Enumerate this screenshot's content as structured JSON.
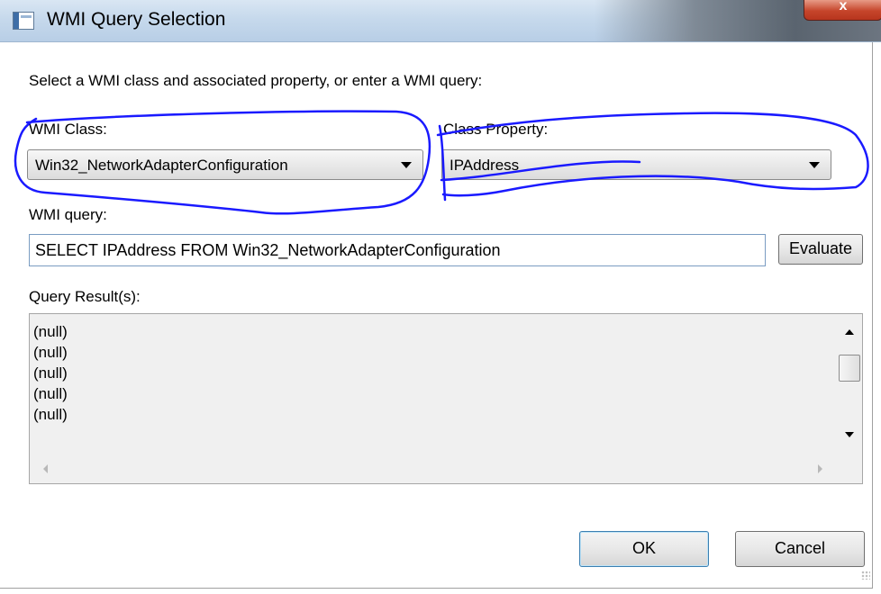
{
  "window": {
    "title": "WMI Query Selection",
    "close_glyph": "x"
  },
  "dialog": {
    "instruction": "Select a WMI class and associated property, or enter a WMI query:",
    "wmi_class": {
      "label": "WMI Class:",
      "selected": "Win32_NetworkAdapterConfiguration"
    },
    "class_property": {
      "label": "Class Property:",
      "selected": "IPAddress"
    },
    "wmi_query": {
      "label": "WMI query:",
      "value": "SELECT IPAddress FROM Win32_NetworkAdapterConfiguration"
    },
    "evaluate_button": "Evaluate",
    "results": {
      "label": "Query Result(s):",
      "rows": [
        "(null)",
        "(null)",
        "(null)",
        "(null)",
        "(null)"
      ]
    },
    "ok_button": "OK",
    "cancel_button": "Cancel"
  },
  "icons": {
    "app": "window-app-icon",
    "close": "close-icon",
    "dropdown": "chevron-down-icon",
    "scroll_up": "scroll-up-arrow-icon",
    "scroll_down": "scroll-down-arrow-icon",
    "scroll_left": "scroll-left-arrow-icon",
    "scroll_right": "scroll-right-arrow-icon"
  },
  "colors": {
    "annotation_ink": "#1a1aff",
    "title_bar": "#c6d9ec",
    "close_button": "#c6452b",
    "default_button_border": "#3c7fb1"
  }
}
